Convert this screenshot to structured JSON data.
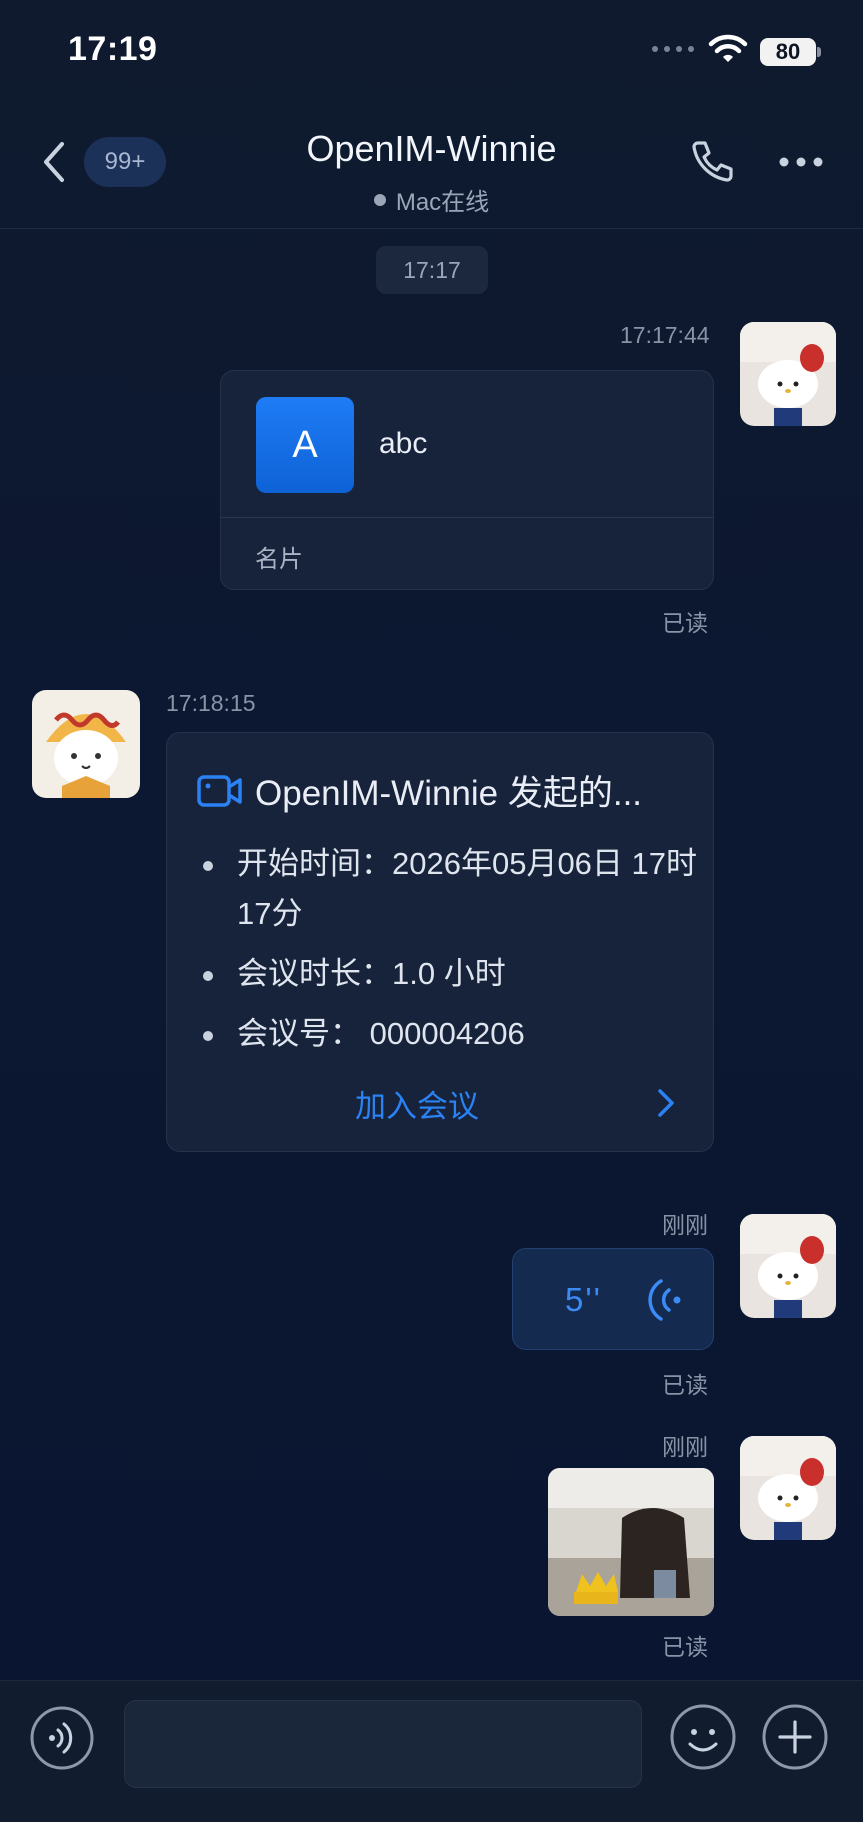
{
  "status_bar": {
    "time": "17:19",
    "battery": "80"
  },
  "header": {
    "unread_badge": "99+",
    "title": "OpenIM-Winnie",
    "subtitle": "Mac在线"
  },
  "time_separator": "17:17",
  "messages": {
    "card": {
      "timestamp": "17:17:44",
      "avatar_letter": "A",
      "name": "abc",
      "label": "名片",
      "status": "已读"
    },
    "meeting": {
      "timestamp": "17:18:15",
      "title": "OpenIM-Winnie 发起的...",
      "start_time": "开始时间：2026年05月06日 17时17分",
      "duration": "会议时长：1.0 小时",
      "meeting_no": "会议号： 000004206",
      "join_label": "加入会议"
    },
    "voice": {
      "timestamp": "刚刚",
      "duration": "5''",
      "status": "已读"
    },
    "image": {
      "timestamp": "刚刚",
      "status": "已读"
    }
  },
  "colors": {
    "background": "#0c1831",
    "accent": "#2a82f5",
    "bubble": "#17233a"
  },
  "icons": [
    "back-icon",
    "phone-icon",
    "more-icon",
    "video-camera-icon",
    "chevron-right-icon",
    "voice-wave-icon",
    "voice-toggle-icon",
    "emoji-icon",
    "plus-icon",
    "wifi-icon"
  ]
}
